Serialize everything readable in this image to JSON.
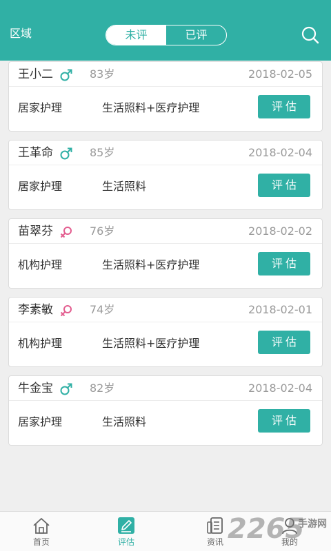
{
  "header": {
    "region_label": "区域",
    "tabs": [
      {
        "label": "未评",
        "active": true
      },
      {
        "label": "已评",
        "active": false
      }
    ],
    "search_icon": "search-icon",
    "background_color": "#30b0a5"
  },
  "records": [
    {
      "name": "王小二",
      "gender": "male",
      "age": "83岁",
      "date": "2018-02-05",
      "care_type": "居家护理",
      "service": "生活照料+医疗护理",
      "button": "评估"
    },
    {
      "name": "王革命",
      "gender": "male",
      "age": "85岁",
      "date": "2018-02-04",
      "care_type": "居家护理",
      "service": "生活照料",
      "button": "评估"
    },
    {
      "name": "苗翠芬",
      "gender": "female",
      "age": "76岁",
      "date": "2018-02-02",
      "care_type": "机构护理",
      "service": "生活照料+医疗护理",
      "button": "评估"
    },
    {
      "name": "李素敏",
      "gender": "female",
      "age": "74岁",
      "date": "2018-02-01",
      "care_type": "机构护理",
      "service": "生活照料+医疗护理",
      "button": "评估"
    },
    {
      "name": "牛金宝",
      "gender": "male",
      "age": "82岁",
      "date": "2018-02-04",
      "care_type": "居家护理",
      "service": "生活照料",
      "button": "评估"
    }
  ],
  "tabbar": [
    {
      "label": "首页",
      "icon": "home-icon",
      "active": false
    },
    {
      "label": "评估",
      "icon": "evaluate-icon",
      "active": true
    },
    {
      "label": "资讯",
      "icon": "news-icon",
      "active": false
    },
    {
      "label": "我的",
      "icon": "profile-icon",
      "active": false
    }
  ],
  "watermark": {
    "text": "2265",
    "sub_text": "手游网"
  },
  "colors": {
    "accent": "#30b0a5",
    "male": "#30b0a5",
    "female": "#e35d8f",
    "muted": "#9a9a9a"
  }
}
